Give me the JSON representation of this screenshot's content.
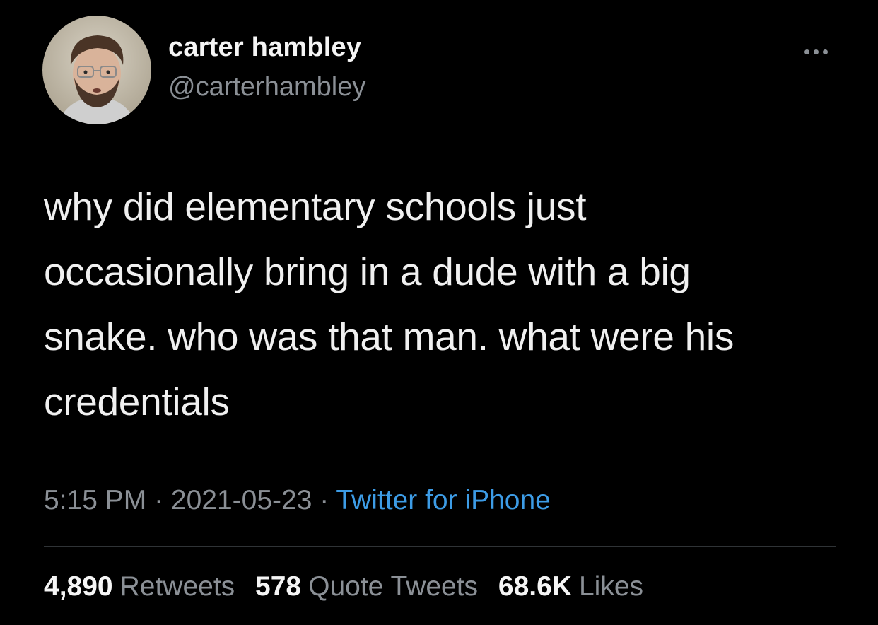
{
  "author": {
    "display_name": "carter hambley",
    "handle": "@carterhambley",
    "avatar_icon": "profile-photo"
  },
  "menu_icon": "more-horizontal-icon",
  "tweet": {
    "lines": [
      "why did elementary schools just",
      "occasionally bring in a dude with a big",
      "snake. who was that man. what were his",
      "credentials"
    ]
  },
  "meta": {
    "time": "5:15 PM",
    "separator": "·",
    "date": "2021-05-23",
    "source": "Twitter for iPhone"
  },
  "stats": {
    "retweets_count": "4,890",
    "retweets_label": "Retweets",
    "quotes_count": "578",
    "quotes_label": "Quote Tweets",
    "likes_count": "68.6K",
    "likes_label": "Likes"
  },
  "colors": {
    "background": "#000000",
    "text": "#f0f0f0",
    "secondary": "#8b9096",
    "link": "#3d9ce6",
    "divider": "#2f3336"
  }
}
